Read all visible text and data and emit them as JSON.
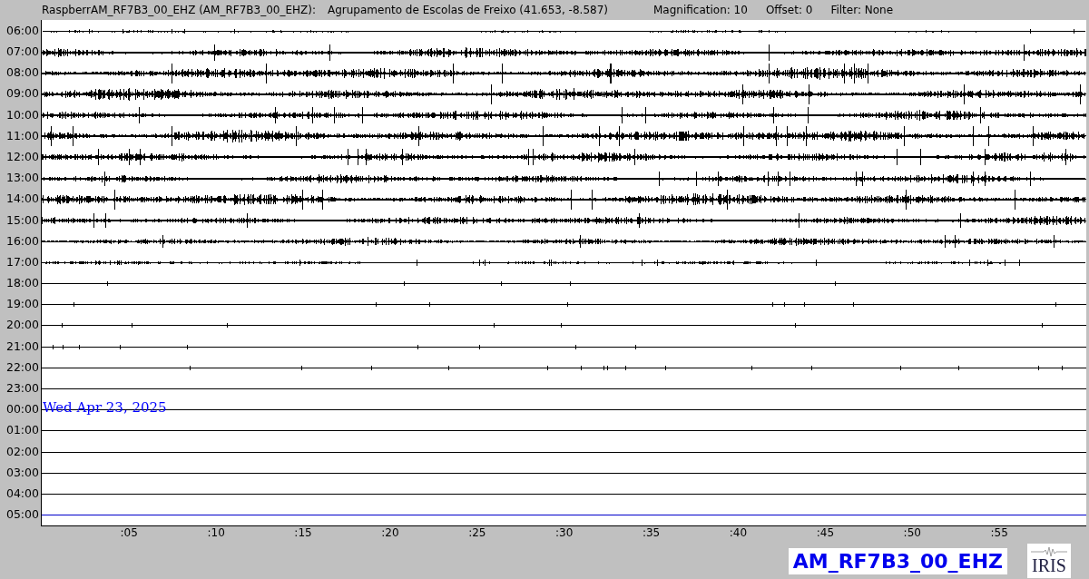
{
  "header": {
    "station": "RaspberrAM_RF7B3_00_EHZ (AM_RF7B3_00_EHZ):",
    "location": "Agrupamento de Escolas de Freixo (41.653, -8.587)",
    "magnification": "Magnification: 10",
    "offset": "Offset: 0",
    "filter": "Filter: None"
  },
  "rows": [
    {
      "label": "06:00",
      "color": "#000000"
    },
    {
      "label": "07:00",
      "color": "#000000"
    },
    {
      "label": "08:00",
      "color": "#000000"
    },
    {
      "label": "09:00",
      "color": "#000000"
    },
    {
      "label": "10:00",
      "color": "#000000"
    },
    {
      "label": "11:00",
      "color": "#000000"
    },
    {
      "label": "12:00",
      "color": "#000000"
    },
    {
      "label": "13:00",
      "color": "#000000"
    },
    {
      "label": "14:00",
      "color": "#000000"
    },
    {
      "label": "15:00",
      "color": "#000000"
    },
    {
      "label": "16:00",
      "color": "#000000"
    },
    {
      "label": "17:00",
      "color": "#000000"
    },
    {
      "label": "18:00",
      "color": "#000000"
    },
    {
      "label": "19:00",
      "color": "#000000"
    },
    {
      "label": "20:00",
      "color": "#000000"
    },
    {
      "label": "21:00",
      "color": "#000000"
    },
    {
      "label": "22:00",
      "color": "#000000"
    },
    {
      "label": "23:00",
      "color": "#000000"
    },
    {
      "label": "00:00",
      "color": "#000000"
    },
    {
      "label": "01:00",
      "color": "#000000"
    },
    {
      "label": "02:00",
      "color": "#000000"
    },
    {
      "label": "03:00",
      "color": "#000000"
    },
    {
      "label": "04:00",
      "color": "#000000"
    },
    {
      "label": "05:00",
      "color": "#0000cc"
    }
  ],
  "date_label": "Wed Apr 23, 2025",
  "x_ticks": [
    ":05",
    ":10",
    ":15",
    ":20",
    ":25",
    ":30",
    ":35",
    ":40",
    ":45",
    ":50",
    ":55"
  ],
  "channel_badge": "AM_RF7B3_00_EHZ",
  "logo_text": "IRIS"
}
